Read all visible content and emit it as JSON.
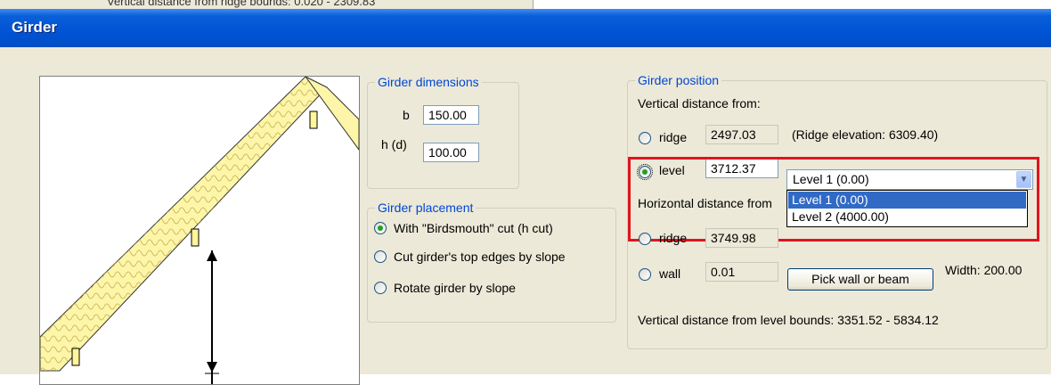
{
  "background_window": {
    "text": "Vertical distance from ridge bounds: 0.020 - 2309.83"
  },
  "dialog": {
    "title": "Girder"
  },
  "dimensions": {
    "legend": "Girder dimensions",
    "b_label": "b",
    "b_value": "150.00",
    "h_label": "h (d)",
    "h_value": "100.00"
  },
  "placement": {
    "legend": "Girder placement",
    "options": [
      {
        "label": "With \"Birdsmouth\" cut (h cut)",
        "checked": true
      },
      {
        "label": "Cut girder's top edges by slope",
        "checked": false
      },
      {
        "label": "Rotate girder by slope",
        "checked": false
      }
    ]
  },
  "position": {
    "legend": "Girder position",
    "vertical_heading": "Vertical distance from:",
    "ridge_label": "ridge",
    "ridge_value": "2497.03",
    "ridge_elevation": "(Ridge elevation: 6309.40)",
    "level_label": "level",
    "level_value": "3712.37",
    "level_combo_value": "Level 1 (0.00)",
    "level_options": [
      "Level 1 (0.00)",
      "Level 2 (4000.00)"
    ],
    "horizontal_heading": "Horizontal distance from",
    "h_ridge_label": "ridge",
    "h_ridge_value": "3749.98",
    "wall_label": "wall",
    "wall_value": "0.01",
    "pick_button": "Pick wall or beam",
    "width_text": "Width: 200.00",
    "bounds_text": "Vertical distance from level bounds: 3351.52 - 5834.12"
  },
  "colors": {
    "accent": "#0046d5",
    "selection": "#316ac5",
    "highlight": "#e0141e",
    "title_bar": "#0053d6"
  }
}
